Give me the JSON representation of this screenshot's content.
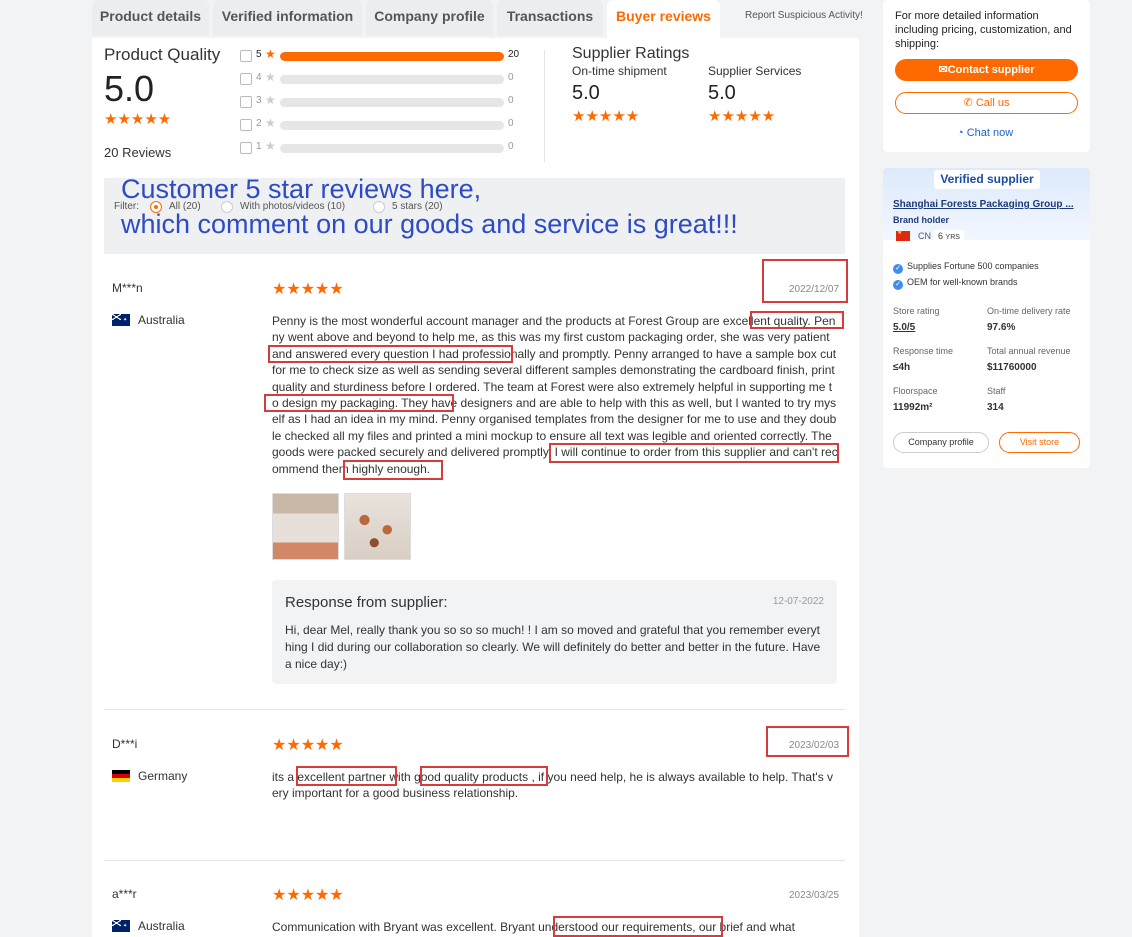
{
  "tabs": [
    {
      "label": "Product details"
    },
    {
      "label": "Verified information"
    },
    {
      "label": "Company profile"
    },
    {
      "label": "Transactions"
    },
    {
      "label": "Buyer reviews"
    }
  ],
  "active_tab": "Buyer reviews",
  "report_link": "Report Suspicious Activity!",
  "product_quality": {
    "title": "Product Quality",
    "score": "5.0",
    "stars": "★★★★★",
    "reviews_count": "20 Reviews",
    "breakdown": [
      {
        "star": "5",
        "count": "20",
        "fraction": 1.0
      },
      {
        "star": "4",
        "count": "0",
        "fraction": 0
      },
      {
        "star": "3",
        "count": "0",
        "fraction": 0
      },
      {
        "star": "2",
        "count": "0",
        "fraction": 0
      },
      {
        "star": "1",
        "count": "0",
        "fraction": 0
      }
    ]
  },
  "supplier_ratings": {
    "title": "Supplier Ratings",
    "ontime_label": "On-time shipment",
    "ontime_score": "5.0",
    "service_label": "Supplier Services",
    "service_score": "5.0",
    "stars": "★★★★★"
  },
  "filter": {
    "label": "Filter:",
    "options": [
      "All (20)",
      "With photos/videos (10)",
      "5 stars (20)"
    ],
    "selected": "All (20)"
  },
  "overlay_caption": {
    "line1": "Customer 5 star reviews here,",
    "line2": "which comment on our goods and service is great!!!"
  },
  "reviews": [
    {
      "name": "M***n",
      "country": "Australia",
      "date": "2022/12/07",
      "stars": "★★★★★",
      "text": "Penny is the most wonderful account manager and the products at Forest Group are excellent quality. Penny went above and beyond to help me, as this was my first custom packaging order, she was very patient and answered every question I had professionally and promptly. Penny arranged to have a sample box cut for me to check size as well as sending several different samples demonstrating the cardboard finish, print quality and sturdiness before I ordered. The team at Forest were also extremely helpful in supporting me to design my packaging. They have designers and are able to help with this as well, but I wanted to try myself as I had an idea in my mind. Penny organised templates from the designer for me to use and they double checked all my files and printed a mini mockup to ensure all text was legible and oriented correctly. The goods were packed securely and delivered promptly. I will continue to order from this supplier and can't recommend them highly enough.",
      "response": {
        "title": "Response from supplier:",
        "date": "12-07-2022",
        "text": "Hi, dear Mel, really thank you so so so much! ! I am so moved and grateful that you remember everything I did during our collaboration so clearly. We will definitely do better and better in the future. Have a nice day:)"
      }
    },
    {
      "name": "D***i",
      "country": "Germany",
      "date": "2023/02/03",
      "stars": "★★★★★",
      "text": "its a excellent partner with good quality products , if you need help, he is always available to help. That's very important for a good business relationship."
    },
    {
      "name": "a***r",
      "country": "Australia",
      "date": "2023/03/25",
      "stars": "★★★★★",
      "text": "Communication with Bryant was excellent. Bryant understood our requirements, our brief and what"
    }
  ],
  "contact_panel": {
    "info": "For more detailed information including pricing, customization, and shipping:",
    "contact_label": "Contact supplier",
    "call_label": "Call us",
    "chat_label": "Chat now"
  },
  "supplier_card": {
    "badge": "Verified supplier",
    "company": "Shanghai Forests Packaging Group ...",
    "brand": "Brand holder",
    "country": "CN",
    "years_num": "6",
    "years_unit": "YRS",
    "features": [
      "Supplies Fortune 500 companies",
      "OEM for well-known brands"
    ],
    "stats": [
      {
        "label": "Store rating",
        "value": "5.0/5"
      },
      {
        "label": "On-time delivery rate",
        "value": "97.6%"
      },
      {
        "label": "Response time",
        "value": "≤4h"
      },
      {
        "label": "Total annual revenue",
        "value": "$11760000"
      },
      {
        "label": "Floorspace",
        "value": "11992m²"
      },
      {
        "label": "Staff",
        "value": "314"
      }
    ],
    "company_profile_label": "Company profile",
    "visit_store_label": "Visit store"
  },
  "colors": {
    "accent": "#ff6a00",
    "annotation": "#d83b3b",
    "caption": "#2e4bc6",
    "link": "#1a66cc"
  }
}
